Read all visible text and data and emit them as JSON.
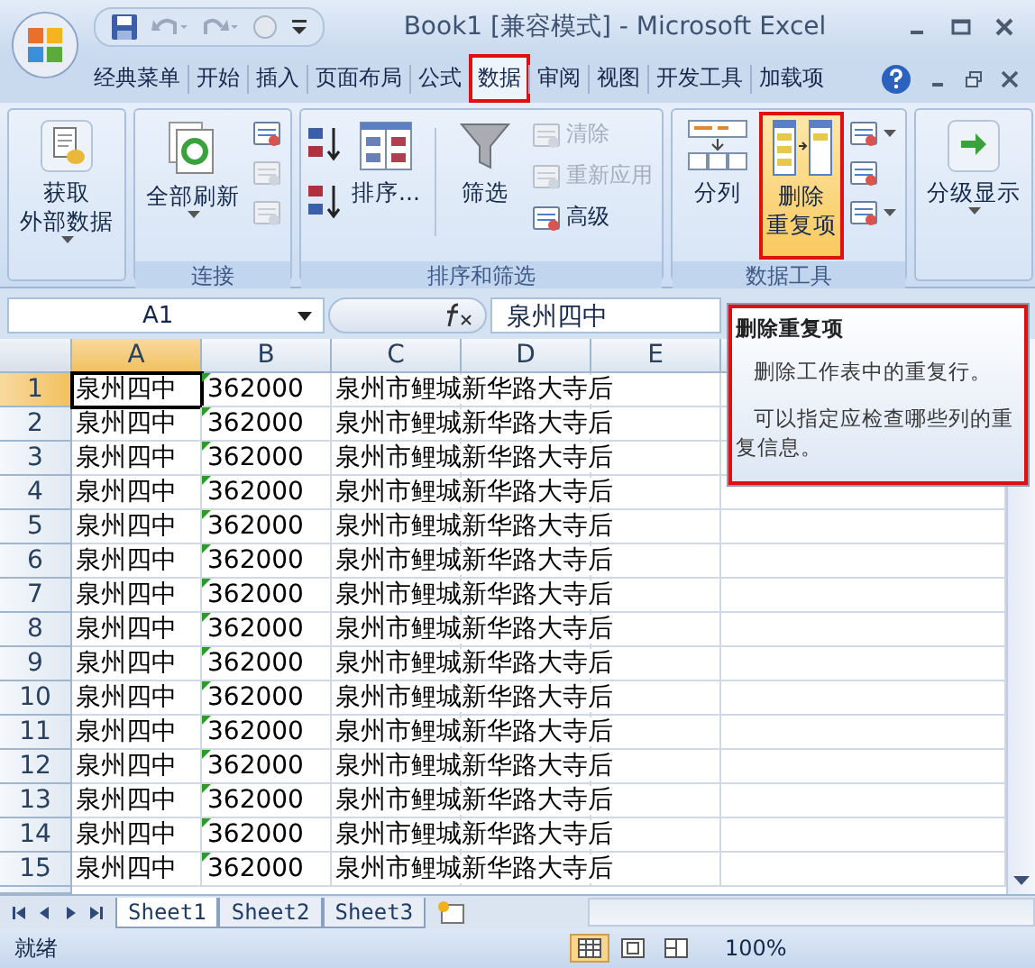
{
  "window": {
    "title": "Book1  [兼容模式] - Microsoft Excel"
  },
  "tabs": [
    {
      "label": "经典菜单",
      "selected": false,
      "marked": false
    },
    {
      "label": "开始",
      "selected": false,
      "marked": false
    },
    {
      "label": "插入",
      "selected": false,
      "marked": false
    },
    {
      "label": "页面布局",
      "selected": false,
      "marked": false
    },
    {
      "label": "公式",
      "selected": false,
      "marked": false
    },
    {
      "label": "数据",
      "selected": true,
      "marked": true
    },
    {
      "label": "审阅",
      "selected": false,
      "marked": false
    },
    {
      "label": "视图",
      "selected": false,
      "marked": false
    },
    {
      "label": "开发工具",
      "selected": false,
      "marked": false
    },
    {
      "label": "加载项",
      "selected": false,
      "marked": false
    }
  ],
  "ribbon": {
    "groups": [
      {
        "items": [
          {
            "kind": "large",
            "lines": [
              "获取",
              "外部数据"
            ],
            "dropdown": true,
            "selected": false,
            "marked": false
          }
        ]
      },
      {
        "title": "连接",
        "items": [
          {
            "kind": "large",
            "lines": [
              "全部刷新"
            ],
            "dropdown": true,
            "selected": false,
            "marked": false
          },
          {
            "kind": "stack",
            "tools": [
              {
                "disabled": false,
                "dropdown": false
              },
              {
                "disabled": true,
                "dropdown": false
              },
              {
                "disabled": true,
                "dropdown": false
              }
            ]
          }
        ]
      },
      {
        "title": "排序和筛选",
        "items": [
          {
            "kind": "sortstack"
          },
          {
            "kind": "large",
            "lines": [
              "排序..."
            ],
            "dropdown": false,
            "selected": false,
            "marked": false
          },
          {
            "kind": "separator"
          },
          {
            "kind": "large",
            "lines": [
              "筛选"
            ],
            "dropdown": false,
            "selected": false,
            "marked": false
          },
          {
            "kind": "stack",
            "tools": [
              {
                "label": "清除",
                "disabled": true,
                "dropdown": false
              },
              {
                "label": "重新应用",
                "disabled": true,
                "dropdown": false
              },
              {
                "label": "高级",
                "disabled": false,
                "dropdown": false
              }
            ]
          }
        ]
      },
      {
        "title": "数据工具",
        "items": [
          {
            "kind": "large",
            "lines": [
              "分列"
            ],
            "dropdown": false,
            "selected": false,
            "marked": false
          },
          {
            "kind": "large",
            "lines": [
              "删除",
              "重复项"
            ],
            "dropdown": false,
            "selected": true,
            "marked": true
          },
          {
            "kind": "stack",
            "tools": [
              {
                "disabled": false,
                "dropdown": true
              },
              {
                "disabled": false,
                "dropdown": false
              },
              {
                "disabled": false,
                "dropdown": true
              }
            ]
          }
        ]
      },
      {
        "items": [
          {
            "kind": "large",
            "lines": [
              "分级显示"
            ],
            "dropdown": true,
            "selected": false,
            "marked": false
          }
        ]
      }
    ]
  },
  "formula_bar": {
    "name_box": "A1",
    "value": "泉州四中"
  },
  "columns": [
    {
      "label": "A",
      "selected": true
    },
    {
      "label": "B",
      "selected": false
    },
    {
      "label": "C",
      "selected": false
    },
    {
      "label": "D",
      "selected": false
    },
    {
      "label": "E",
      "selected": false
    }
  ],
  "rows": [
    {
      "number": "1",
      "selected": true,
      "flag": true,
      "cells": [
        "泉州四中",
        "362000",
        "泉州市鲤城新华路大寺后"
      ]
    },
    {
      "number": "2",
      "selected": false,
      "flag": true,
      "cells": [
        "泉州四中",
        "362000",
        "泉州市鲤城新华路大寺后"
      ]
    },
    {
      "number": "3",
      "selected": false,
      "flag": true,
      "cells": [
        "泉州四中",
        "362000",
        "泉州市鲤城新华路大寺后"
      ]
    },
    {
      "number": "4",
      "selected": false,
      "flag": true,
      "cells": [
        "泉州四中",
        "362000",
        "泉州市鲤城新华路大寺后"
      ]
    },
    {
      "number": "5",
      "selected": false,
      "flag": true,
      "cells": [
        "泉州四中",
        "362000",
        "泉州市鲤城新华路大寺后"
      ]
    },
    {
      "number": "6",
      "selected": false,
      "flag": true,
      "cells": [
        "泉州四中",
        "362000",
        "泉州市鲤城新华路大寺后"
      ]
    },
    {
      "number": "7",
      "selected": false,
      "flag": true,
      "cells": [
        "泉州四中",
        "362000",
        "泉州市鲤城新华路大寺后"
      ]
    },
    {
      "number": "8",
      "selected": false,
      "flag": true,
      "cells": [
        "泉州四中",
        "362000",
        "泉州市鲤城新华路大寺后"
      ]
    },
    {
      "number": "9",
      "selected": false,
      "flag": true,
      "cells": [
        "泉州四中",
        "362000",
        "泉州市鲤城新华路大寺后"
      ]
    },
    {
      "number": "10",
      "selected": false,
      "flag": true,
      "cells": [
        "泉州四中",
        "362000",
        "泉州市鲤城新华路大寺后"
      ]
    },
    {
      "number": "11",
      "selected": false,
      "flag": true,
      "cells": [
        "泉州四中",
        "362000",
        "泉州市鲤城新华路大寺后"
      ]
    },
    {
      "number": "12",
      "selected": false,
      "flag": true,
      "cells": [
        "泉州四中",
        "362000",
        "泉州市鲤城新华路大寺后"
      ]
    },
    {
      "number": "13",
      "selected": false,
      "flag": true,
      "cells": [
        "泉州四中",
        "362000",
        "泉州市鲤城新华路大寺后"
      ]
    },
    {
      "number": "14",
      "selected": false,
      "flag": true,
      "cells": [
        "泉州四中",
        "362000",
        "泉州市鲤城新华路大寺后"
      ]
    },
    {
      "number": "15",
      "selected": false,
      "flag": true,
      "cells": [
        "泉州四中",
        "362000",
        "泉州市鲤城新华路大寺后"
      ]
    }
  ],
  "tooltip": {
    "title": "删除重复项",
    "lines": [
      "删除工作表中的重复行。",
      "可以指定应检查哪些列的重复信息。"
    ],
    "marked": true
  },
  "sheet_tabs": [
    {
      "label": "Sheet1",
      "selected": true
    },
    {
      "label": "Sheet2",
      "selected": false
    },
    {
      "label": "Sheet3",
      "selected": false
    }
  ],
  "status_bar": {
    "status": "就绪",
    "views": [
      {
        "selected": true
      },
      {
        "selected": false
      },
      {
        "selected": false
      }
    ],
    "zoom": "100%"
  }
}
